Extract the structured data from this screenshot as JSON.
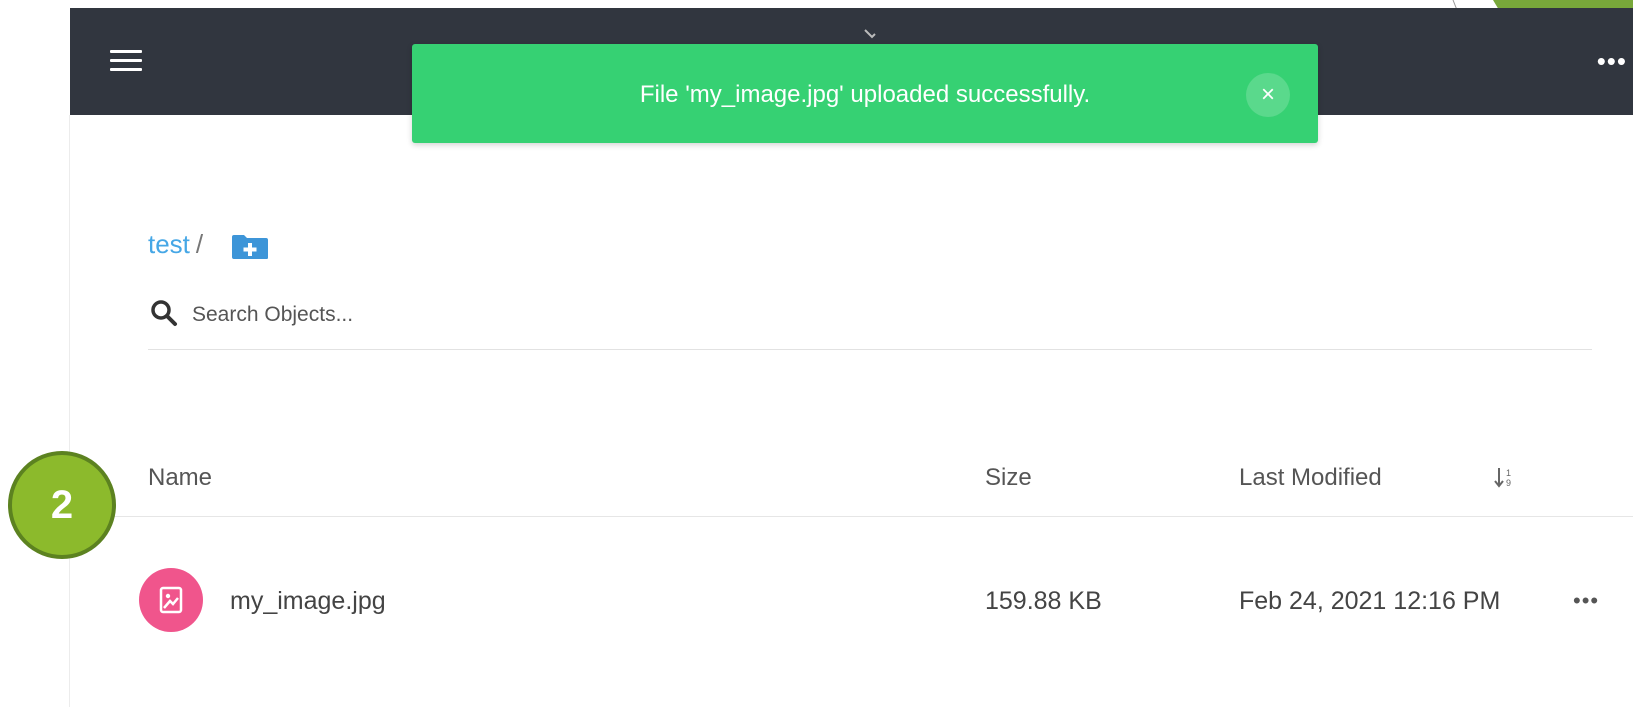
{
  "toast": {
    "message": "File 'my_image.jpg' uploaded successfully.",
    "close_label": "×"
  },
  "breadcrumb": {
    "bucket": "test",
    "separator": "/"
  },
  "search": {
    "placeholder": "Search Objects..."
  },
  "table": {
    "columns": {
      "name": "Name",
      "size": "Size",
      "last_modified": "Last Modified"
    },
    "rows": [
      {
        "name": "my_image.jpg",
        "size": "159.88 KB",
        "last_modified": "Feb 24, 2021 12:16 PM"
      }
    ]
  },
  "step_badge": "2",
  "icons": {
    "menu": "hamburger-menu-icon",
    "more": "more-horizontal-icon",
    "new_folder": "folder-plus-icon",
    "search": "search-icon",
    "sort": "sort-icon",
    "file": "image-file-icon"
  },
  "colors": {
    "header_bg": "#31363f",
    "toast_bg": "#36d173",
    "link": "#46a7e6",
    "file_icon_bg": "#f0558c",
    "badge": "#8cba2c"
  }
}
